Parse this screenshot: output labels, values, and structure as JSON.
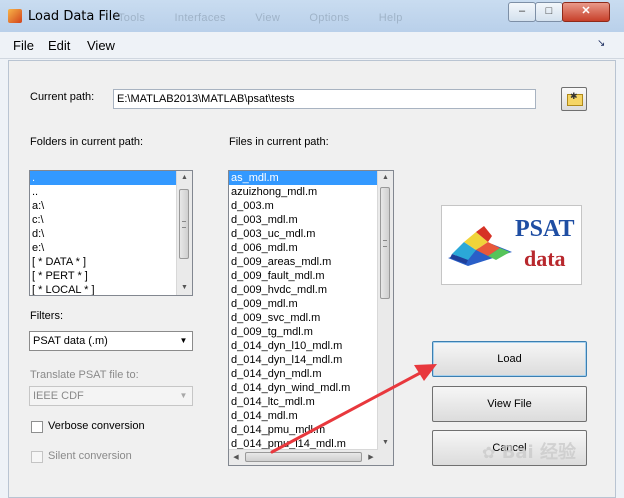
{
  "window": {
    "title": "Load Data File",
    "ghost_menu": [
      "Tools",
      "Interfaces",
      "View",
      "Options",
      "Help"
    ],
    "controls": {
      "minimize": "–",
      "maximize": "□",
      "close": "✕"
    }
  },
  "menubar": {
    "items": [
      "File",
      "Edit",
      "View"
    ],
    "dock_arrow": "↘"
  },
  "current_path": {
    "label": "Current path:",
    "value": "E:\\MATLAB2013\\MATLAB\\psat\\tests"
  },
  "folders": {
    "label": "Folders in current path:",
    "items": [
      ".",
      "..",
      "a:\\",
      "c:\\",
      "d:\\",
      "e:\\",
      "[ * DATA * ]",
      "[ * PERT * ]",
      "[ * LOCAL * ]"
    ],
    "selected_index": 0
  },
  "files": {
    "label": "Files in current path:",
    "items": [
      "as_mdl.m",
      "azuizhong_mdl.m",
      "d_003.m",
      "d_003_mdl.m",
      "d_003_uc_mdl.m",
      "d_006_mdl.m",
      "d_009_areas_mdl.m",
      "d_009_fault_mdl.m",
      "d_009_hvdc_mdl.m",
      "d_009_mdl.m",
      "d_009_svc_mdl.m",
      "d_009_tg_mdl.m",
      "d_014_dyn_l10_mdl.m",
      "d_014_dyn_l14_mdl.m",
      "d_014_dyn_mdl.m",
      "d_014_dyn_wind_mdl.m",
      "d_014_ltc_mdl.m",
      "d_014_mdl.m",
      "d_014_pmu_mdl.m",
      "d_014_pmu_l14_mdl.m"
    ],
    "selected_index": 0
  },
  "filters": {
    "label": "Filters:",
    "selected": "PSAT data (.m)"
  },
  "translate": {
    "label": "Translate PSAT file to:",
    "selected": "IEEE CDF"
  },
  "options": {
    "verbose": {
      "label": "Verbose conversion",
      "checked": false
    },
    "silent": {
      "label": "Silent conversion",
      "checked": false
    }
  },
  "logo": {
    "title": "PSAT",
    "subtitle": "data"
  },
  "buttons": {
    "load": "Load",
    "view_file": "View File",
    "cancel": "Cancel"
  },
  "watermark": "Bai 经验",
  "colors": {
    "selection": "#3399ff",
    "annotation_arrow": "#e8383d",
    "logo_blue": "#1f4ea3",
    "logo_red": "#b8282d"
  }
}
